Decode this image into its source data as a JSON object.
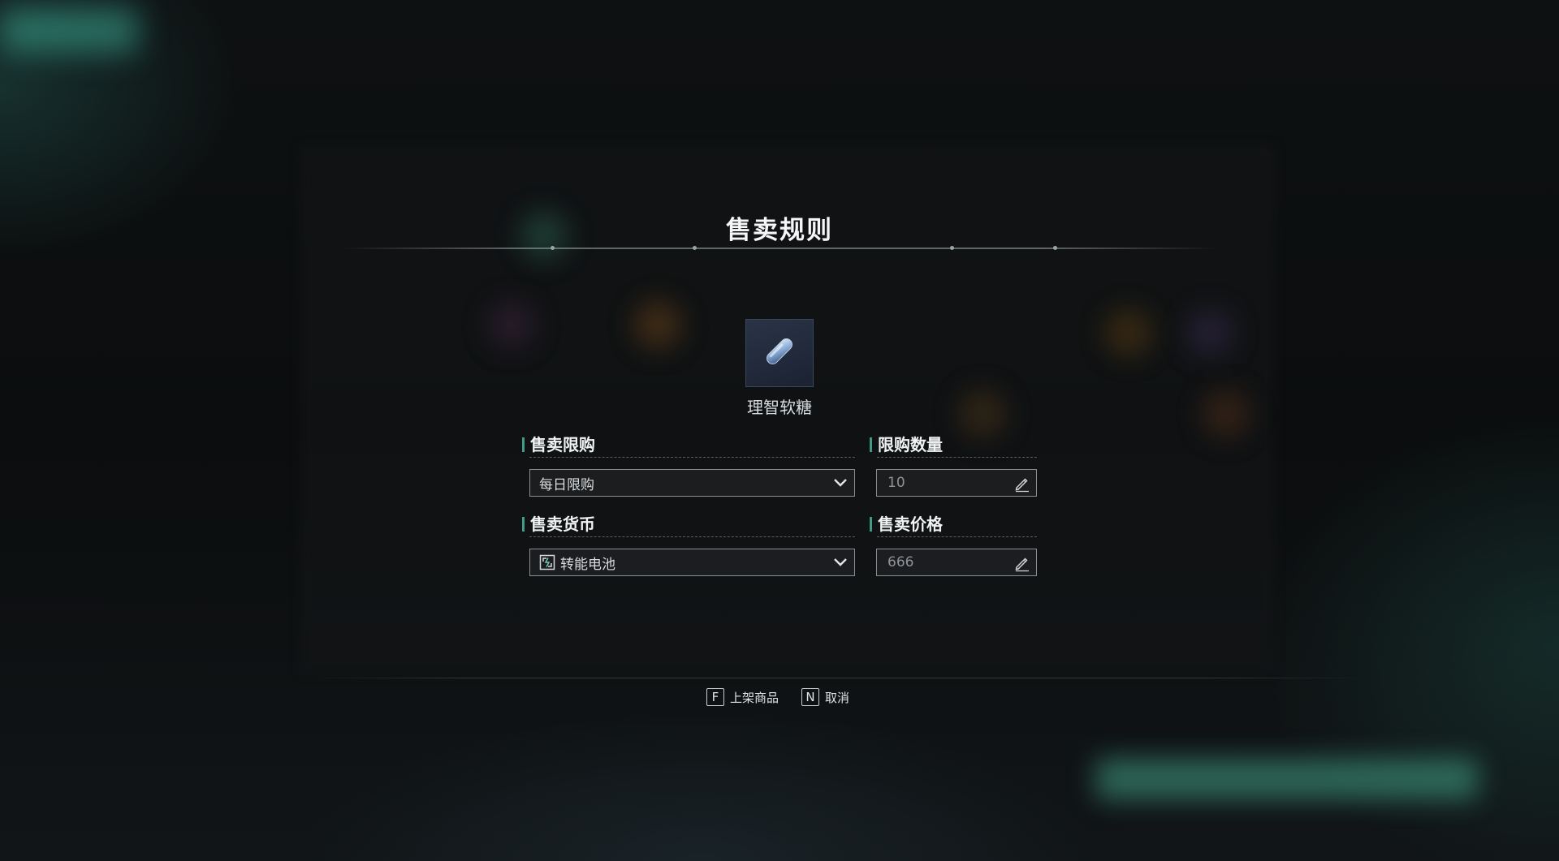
{
  "dialog": {
    "title": "售卖规则"
  },
  "item": {
    "name": "理智软糖",
    "icon": "capsule-icon"
  },
  "fields": {
    "sale_limit": {
      "label": "售卖限购",
      "value": "每日限购"
    },
    "limit_quantity": {
      "label": "限购数量",
      "placeholder": "10"
    },
    "sale_currency": {
      "label": "售卖货币",
      "value": "转能电池",
      "icon": "battery-icon"
    },
    "sale_price": {
      "label": "售卖价格",
      "placeholder": "666"
    }
  },
  "actions": {
    "list_item": {
      "key": "F",
      "label": "上架商品"
    },
    "cancel": {
      "key": "N",
      "label": "取消"
    }
  },
  "colors": {
    "accent": "#3f9c86",
    "field_border": "#8a8f94",
    "item_tile": "#222b3c"
  }
}
